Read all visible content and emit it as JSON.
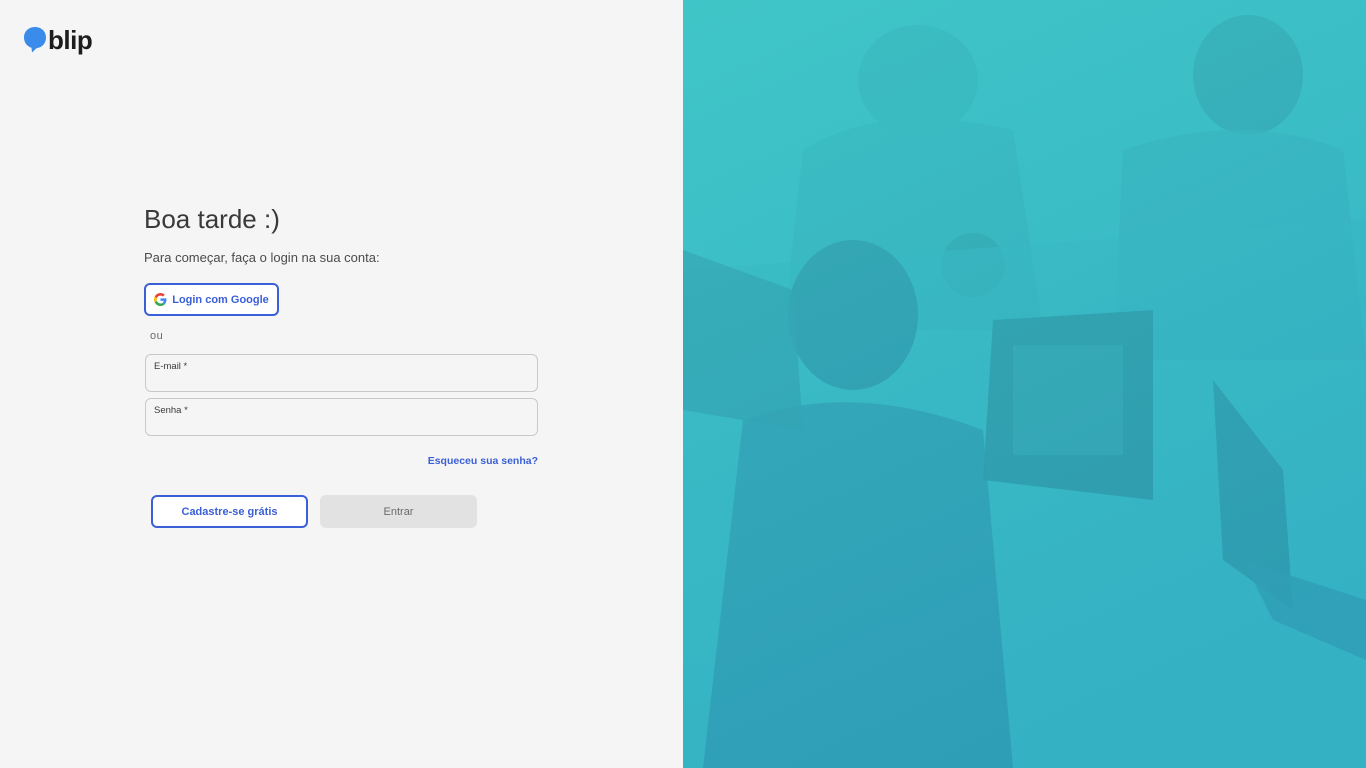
{
  "brand": {
    "logo_text": "blip",
    "logo_icon": "speech-bubble-icon",
    "brand_color": "#3b8bea"
  },
  "login": {
    "greeting": "Boa tarde :)",
    "subtitle": "Para começar, faça o login na sua conta:",
    "google_button_label": "Login com Google",
    "google_icon": "google-g-icon",
    "or_label": "ou",
    "email_label": "E-mail *",
    "email_value": "",
    "password_label": "Senha *",
    "password_value": "",
    "forgot_password_link": "Esqueceu sua senha?",
    "signup_button_label": "Cadastre-se grátis",
    "submit_button_label": "Entrar"
  },
  "colors": {
    "accent": "#3b5fd6",
    "disabled_button": "#e2e2e2",
    "hero_overlay": "#3ec6c6"
  },
  "hero": {
    "image": "people-working-on-laptops-photo"
  }
}
